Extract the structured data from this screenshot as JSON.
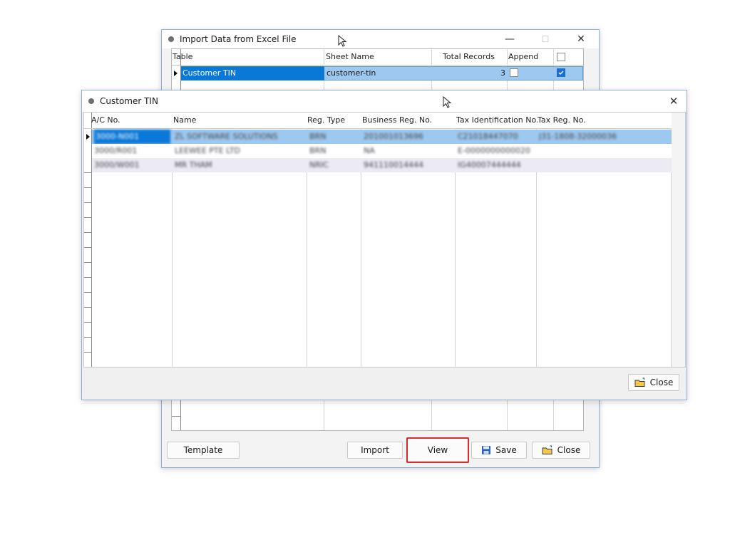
{
  "import_window": {
    "title": "Import Data from Excel File",
    "controls": {
      "minimize": "—",
      "maximize": "☐",
      "close": "✕"
    },
    "columns": [
      "Table",
      "Sheet Name",
      "Total Records",
      "Append"
    ],
    "rows": [
      {
        "table": "Customer TIN",
        "sheet_name": "customer-tin",
        "total_records": "3",
        "append": false,
        "select": true
      }
    ],
    "header_select_all": false,
    "buttons": {
      "template": "Template",
      "import": "Import",
      "view": "View",
      "save": "Save",
      "close": "Close"
    }
  },
  "tin_window": {
    "title": "Customer TIN",
    "close_glyph": "✕",
    "columns": [
      "A/C No.",
      "Name",
      "Reg. Type",
      "Business Reg. No.",
      "Tax Identification No.",
      "Tax Reg. No."
    ],
    "rows": [
      [
        "3000-N001",
        "ZL SOFTWARE SOLUTIONS",
        "BRN",
        "201001013696",
        "C21018447070",
        "J31-1808-32000036"
      ],
      [
        "3000/R001",
        "LEEWEE PTE LTD",
        "BRN",
        "NA",
        "E-0000000000020",
        ""
      ],
      [
        "3000/W001",
        "MR THAM",
        "NRIC",
        "941110014444",
        "IG40007444444",
        ""
      ]
    ],
    "buttons": {
      "close": "Close"
    }
  },
  "colors": {
    "selection": "#0a78d7",
    "selection_soft": "#9dc8ef",
    "alt_row": "#eceaf2",
    "highlight_border": "#d62b2b"
  }
}
